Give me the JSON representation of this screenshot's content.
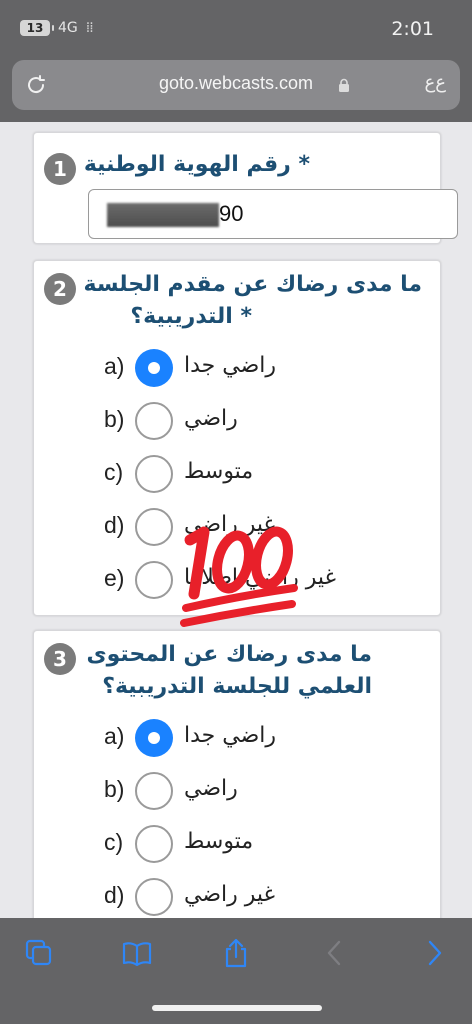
{
  "status_bar": {
    "battery": "13",
    "network": "4G",
    "time": "2:01"
  },
  "browser": {
    "url": "goto.webcasts.com",
    "text_size_button": "ﻉﻉ"
  },
  "questions": [
    {
      "number": "1",
      "title": "* رقم الهوية الوطنية",
      "input_visible_value": "90"
    },
    {
      "number": "2",
      "title_line1": "ما مدى رضاك عن مقدم الجلسة",
      "title_line2": "* التدريبية؟",
      "options": [
        {
          "key": "a)",
          "label": "راضي جدا",
          "selected": true
        },
        {
          "key": "b)",
          "label": "راضي",
          "selected": false
        },
        {
          "key": "c)",
          "label": "متوسط",
          "selected": false
        },
        {
          "key": "d)",
          "label": "غير راضي",
          "selected": false
        },
        {
          "key": "e)",
          "label": "غير راضي إطلاقا",
          "selected": false
        }
      ]
    },
    {
      "number": "3",
      "title_line1": "ما مدى رضاك عن المحتوى",
      "title_line2": "العلمي للجلسة التدريبية؟",
      "options": [
        {
          "key": "a)",
          "label": "راضي جدا",
          "selected": true
        },
        {
          "key": "b)",
          "label": "راضي",
          "selected": false
        },
        {
          "key": "c)",
          "label": "متوسط",
          "selected": false
        },
        {
          "key": "d)",
          "label": "غير راضي",
          "selected": false
        }
      ]
    }
  ],
  "sticker": {
    "icon": "hundred-points-emoji",
    "color": "#e8202a"
  },
  "toolbar": {
    "icons": [
      "tabs-icon",
      "bookmarks-icon",
      "share-icon",
      "back-icon",
      "forward-icon"
    ],
    "accent": "#2f86f6",
    "disabled": "#7e7e82"
  }
}
